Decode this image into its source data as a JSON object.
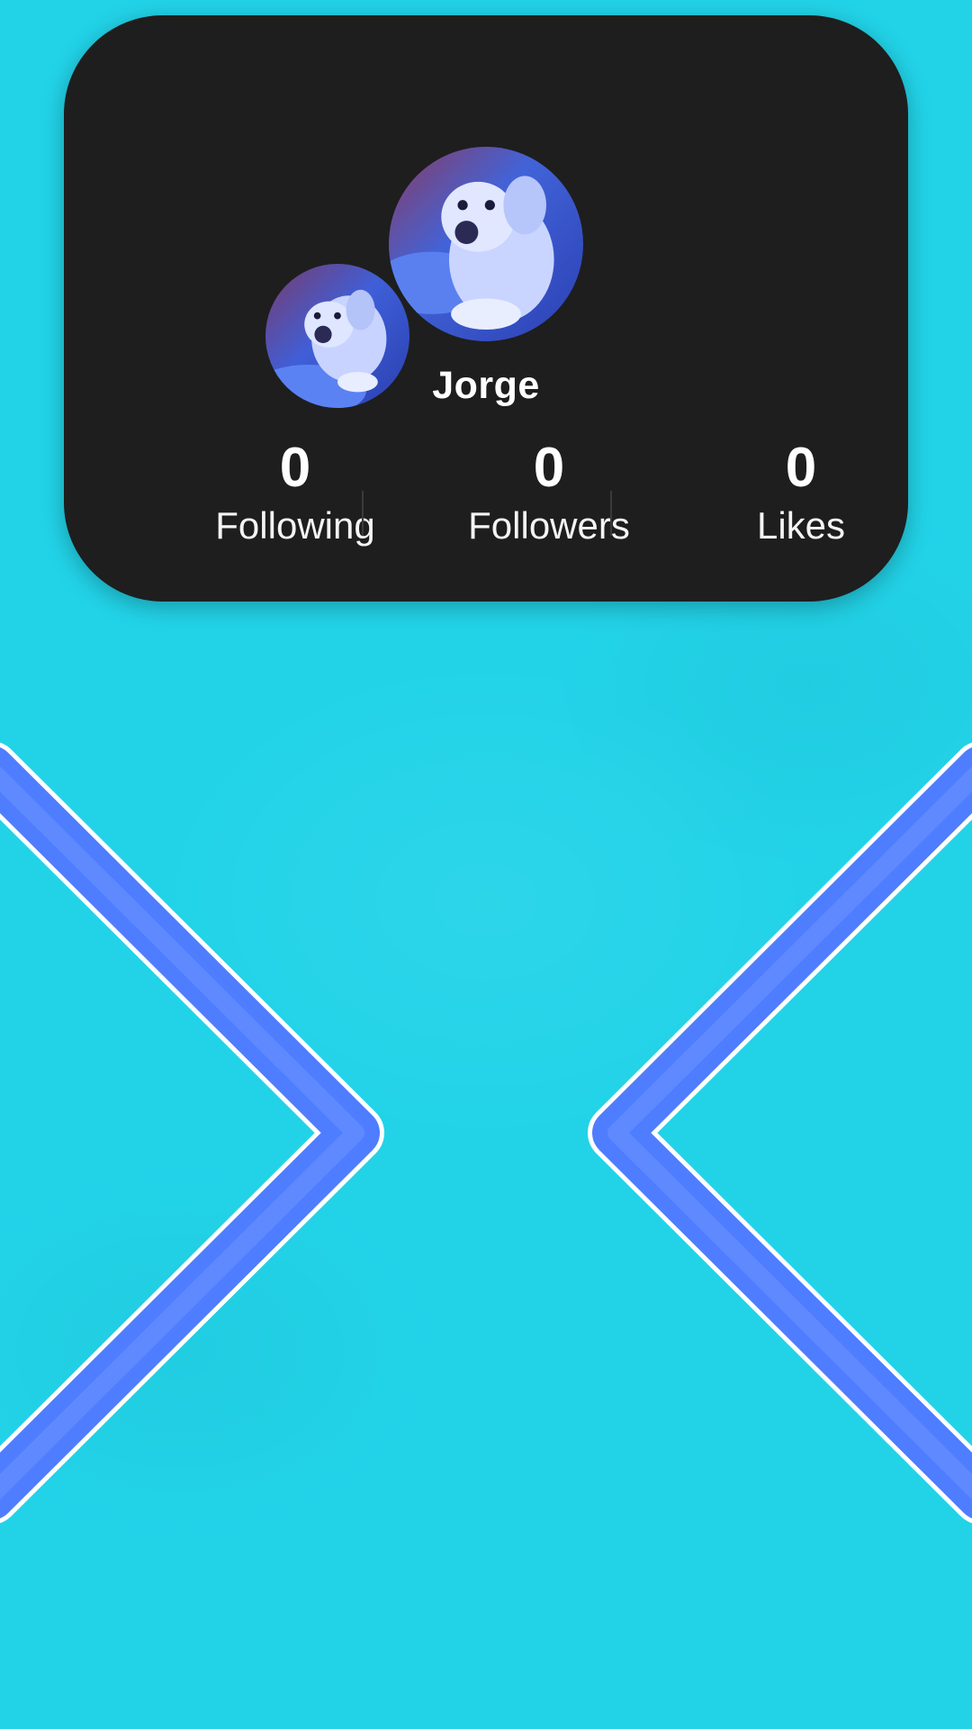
{
  "profile": {
    "username": "Jorge",
    "avatar_description": "white dog photo",
    "stats": [
      {
        "value": "0",
        "label": "Following"
      },
      {
        "value": "0",
        "label": "Followers"
      },
      {
        "value": "0",
        "label": "Likes"
      }
    ]
  },
  "navigation": {
    "left_icon": "chevron-right-icon",
    "right_icon": "chevron-left-icon"
  },
  "colors": {
    "background": "#22d3e8",
    "card": "#1e1e1e",
    "chevron": "#4f7dff",
    "chevron_outline": "#ffffff"
  }
}
